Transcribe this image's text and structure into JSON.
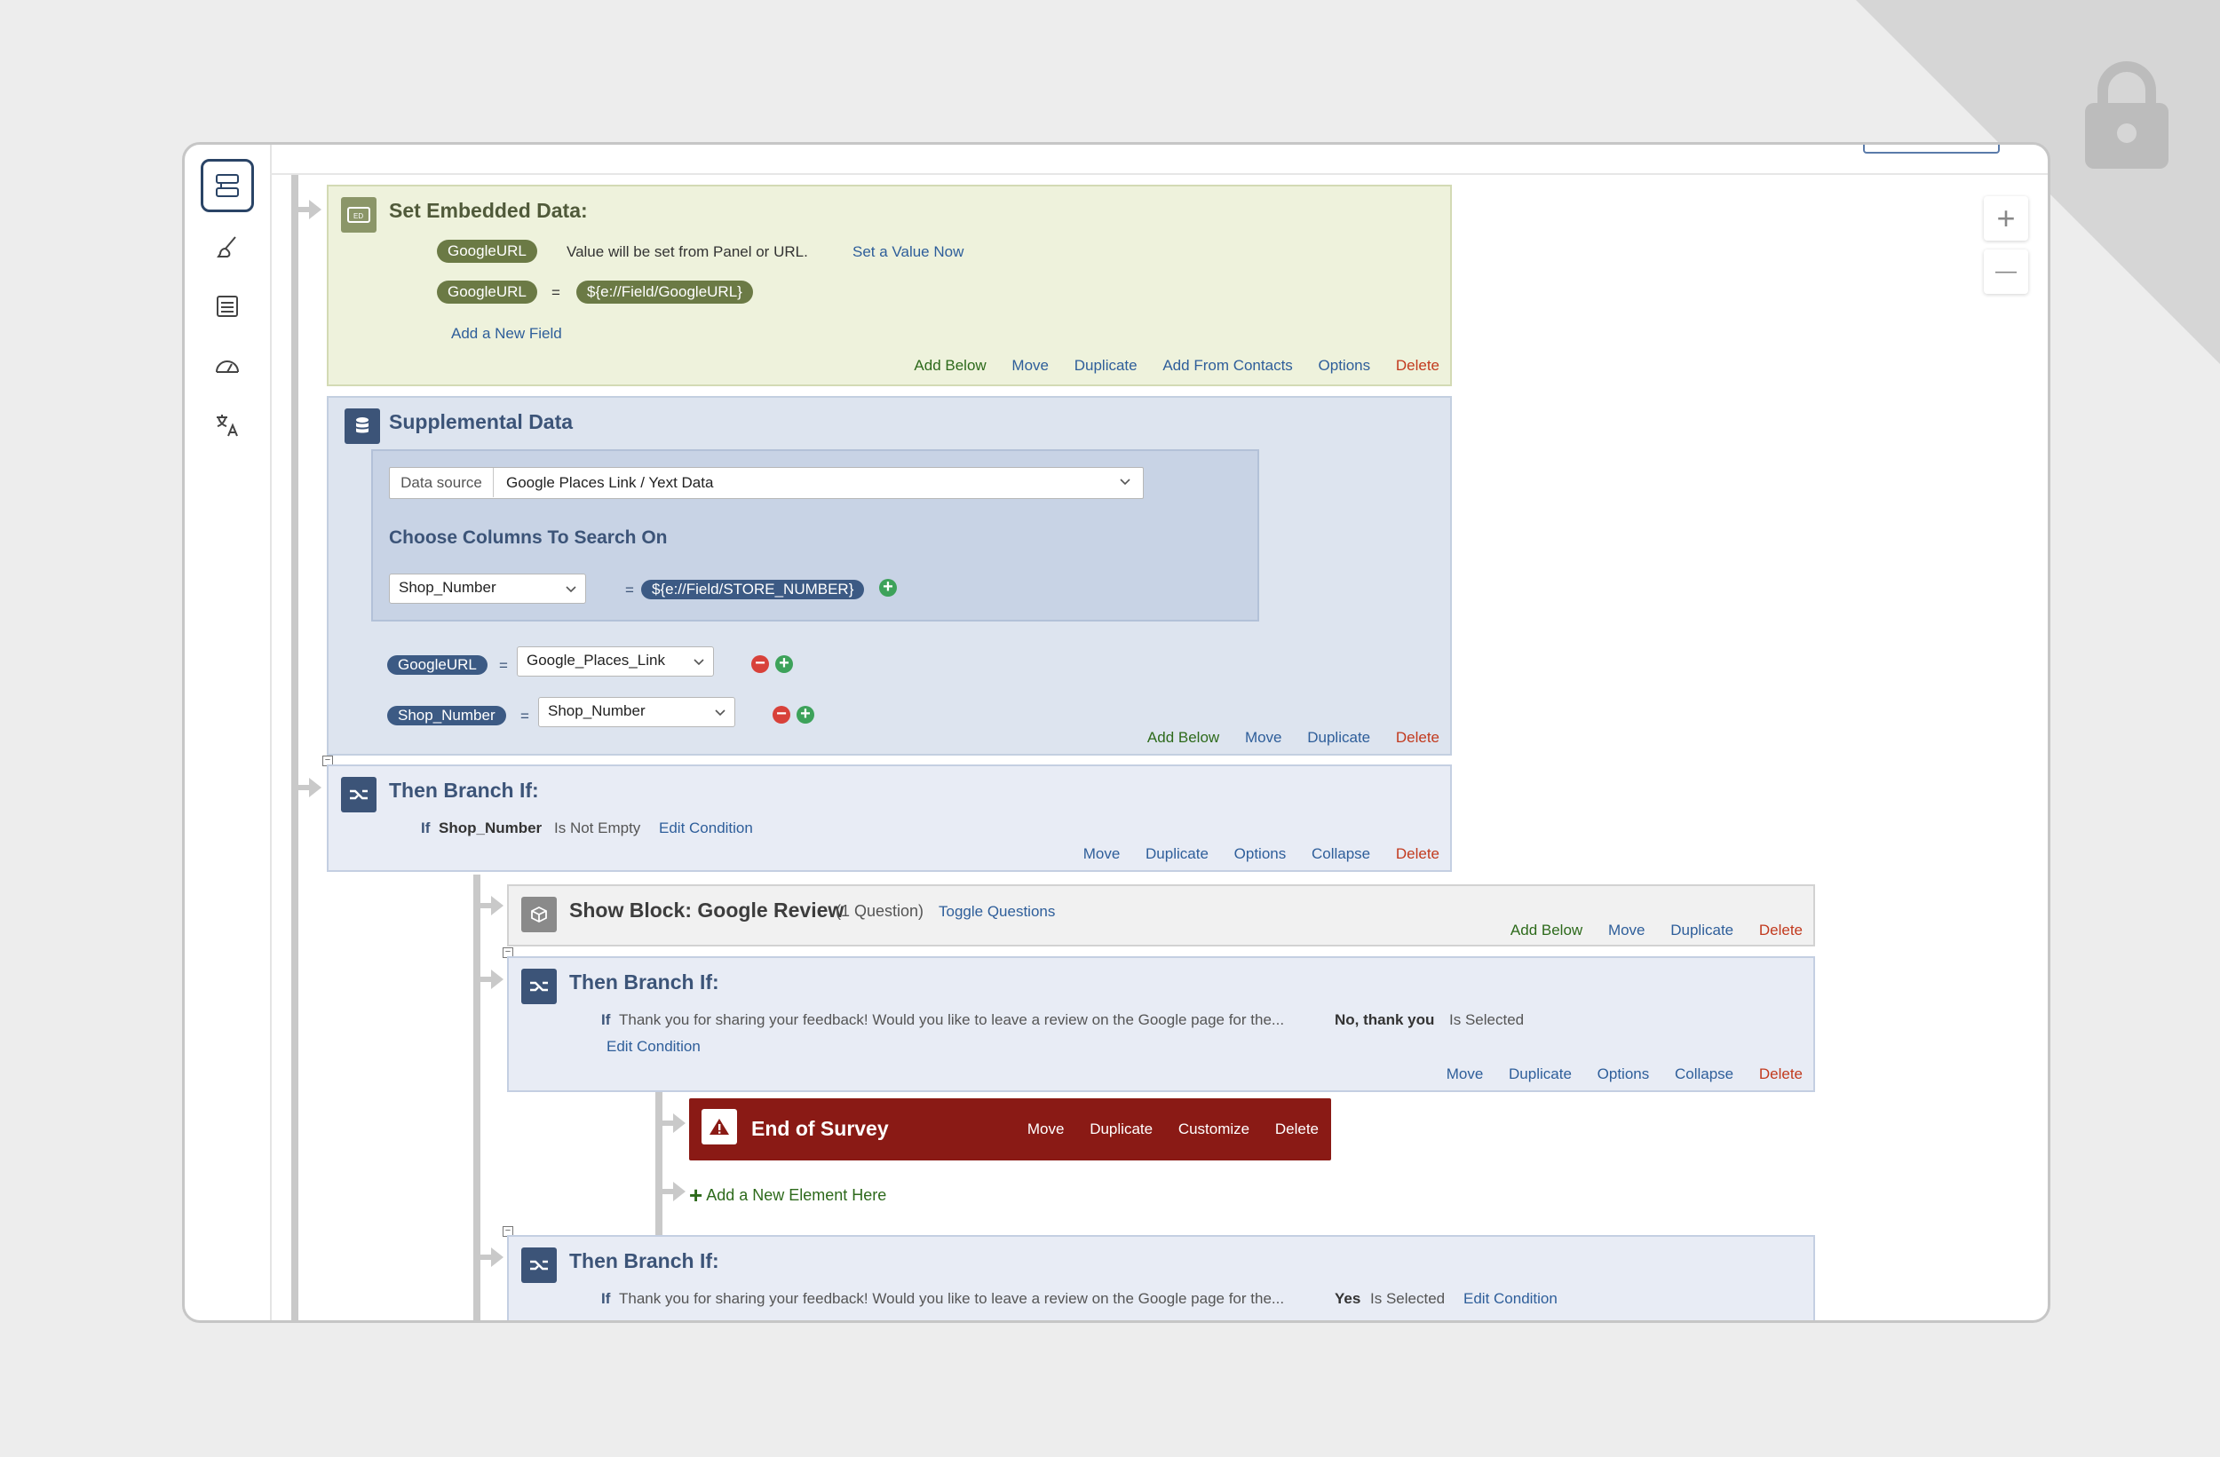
{
  "colors": {
    "olive_accent": "#6b7a45",
    "navy_accent": "#3c5478",
    "end_of_survey_bg": "#8a1a15",
    "link_blue": "#2e5e9a",
    "action_green": "#2d6a1b",
    "delete_red": "#c23a1e"
  },
  "sidebar": {
    "icons": [
      "survey-flow-icon",
      "brush-icon",
      "options-icon",
      "gauge-icon",
      "translate-icon"
    ]
  },
  "zoom": {
    "in_label": "+",
    "out_label": "—"
  },
  "embedded": {
    "title": "Set Embedded Data:",
    "field1_name": "GoogleURL",
    "field1_desc": "Value will be set from Panel or URL.",
    "field1_action": "Set a Value Now",
    "field2_name": "GoogleURL",
    "field2_eq": "=",
    "field2_value": "${e://Field/GoogleURL}",
    "add_field": "Add a New Field",
    "actions": {
      "add_below": "Add Below",
      "move": "Move",
      "duplicate": "Duplicate",
      "add_from_contacts": "Add From Contacts",
      "options": "Options",
      "delete": "Delete"
    }
  },
  "supplemental": {
    "title": "Supplemental Data",
    "data_source_label": "Data source",
    "data_source_value": "Google Places Link / Yext Data",
    "choose_title": "Choose Columns To Search On",
    "search_column": "Shop_Number",
    "search_eq": "=",
    "search_value": "${e://Field/STORE_NUMBER}",
    "map1_field": "GoogleURL",
    "map1_eq": "=",
    "map1_column": "Google_Places_Link",
    "map2_field": "Shop_Number",
    "map2_eq": "=",
    "map2_column": "Shop_Number",
    "actions": {
      "add_below": "Add Below",
      "move": "Move",
      "duplicate": "Duplicate",
      "delete": "Delete"
    }
  },
  "branch1": {
    "title": "Then Branch If:",
    "cond_if": "If",
    "cond_field": "Shop_Number",
    "cond_op": "Is Not Empty",
    "edit": "Edit Condition",
    "actions": {
      "move": "Move",
      "duplicate": "Duplicate",
      "options": "Options",
      "collapse": "Collapse",
      "delete": "Delete"
    }
  },
  "show_block": {
    "title": "Show Block: Google Review",
    "count": "(1 Question)",
    "toggle": "Toggle Questions",
    "actions": {
      "add_below": "Add Below",
      "move": "Move",
      "duplicate": "Duplicate",
      "delete": "Delete"
    }
  },
  "branch2": {
    "title": "Then Branch If:",
    "cond_if": "If",
    "cond_question": "Thank you for sharing your feedback! Would you like to leave a review on the Google page for the...",
    "cond_choice": "No, thank you",
    "cond_op": "Is Selected",
    "edit": "Edit Condition",
    "actions": {
      "move": "Move",
      "duplicate": "Duplicate",
      "options": "Options",
      "collapse": "Collapse",
      "delete": "Delete"
    }
  },
  "end_of_survey": {
    "title": "End of Survey",
    "actions": {
      "move": "Move",
      "duplicate": "Duplicate",
      "customize": "Customize",
      "delete": "Delete"
    }
  },
  "add_element": {
    "plus": "+",
    "label": "Add a New Element Here"
  },
  "branch3": {
    "title": "Then Branch If:",
    "cond_if": "If",
    "cond_question": "Thank you for sharing your feedback! Would you like to leave a review on the Google page for the...",
    "cond_choice": "Yes",
    "cond_op": "Is Selected",
    "edit": "Edit Condition"
  }
}
